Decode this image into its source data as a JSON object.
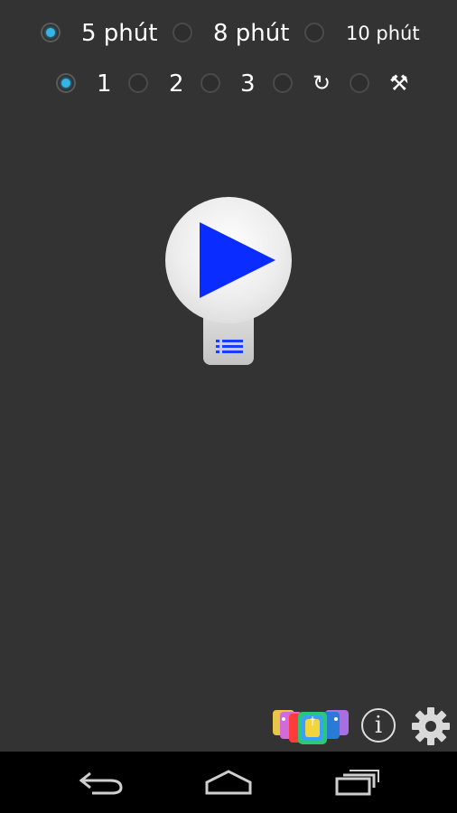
{
  "duration": {
    "options": [
      {
        "label": "5 phút",
        "selected": true
      },
      {
        "label": "8 phút",
        "selected": false
      },
      {
        "label": "10 phút",
        "selected": false
      }
    ]
  },
  "mode": {
    "options": [
      {
        "label": "1",
        "selected": true
      },
      {
        "label": "2",
        "selected": false
      },
      {
        "label": "3",
        "selected": false
      },
      {
        "label": "↻",
        "selected": false
      },
      {
        "label": "⚒",
        "selected": false
      }
    ]
  },
  "main": {
    "play_icon": "play-icon",
    "list_icon": "list-icon"
  },
  "footer": {
    "info_glyph": "i",
    "icons": [
      "apps-icon",
      "info-icon",
      "gear-icon"
    ]
  },
  "navbar": {
    "icons": [
      "back-icon",
      "home-icon",
      "recents-icon"
    ]
  },
  "colors": {
    "background": "#333333",
    "accent": "#33b5e5",
    "play": "#0a2cff",
    "navbar": "#000000"
  }
}
